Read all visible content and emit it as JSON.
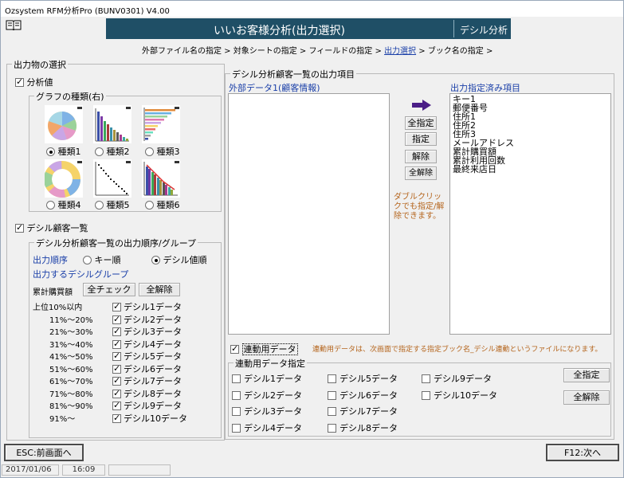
{
  "window": {
    "title": "Ozsystem RFM分析Pro (BUNV0301)   V4.00"
  },
  "banner": {
    "title": "いいお客様分析(出力選択)",
    "subtitle": "デシル分析"
  },
  "steps": [
    "外部ファイル名の指定",
    "対象シートの指定",
    "フィールドの指定",
    "出力選択",
    "ブック名の指定"
  ],
  "output_select": {
    "legend": "出力物の選択",
    "analysis_value": {
      "label": "分析値",
      "checked": true
    },
    "graph_group": {
      "legend": "グラフの種類(右)",
      "types": [
        {
          "label": "種類1",
          "selected": true
        },
        {
          "label": "種類2",
          "selected": false
        },
        {
          "label": "種類3",
          "selected": false
        },
        {
          "label": "種類4",
          "selected": false
        },
        {
          "label": "種類5",
          "selected": false
        },
        {
          "label": "種類6",
          "selected": false
        }
      ]
    },
    "decile_customers": {
      "label": "デシル顧客一覧",
      "checked": true
    },
    "order_group": {
      "legend": "デシル分析顧客一覧の出力順序/グループ",
      "order_label": "出力順序",
      "order_key": "キー順",
      "order_decile": "デシル値順",
      "decile_group_label": "出力するデシルグループ",
      "cum_purchase_label": "累計購買額",
      "check_all": "全チェック",
      "clear_all": "全解除",
      "rows": [
        {
          "range": "上位10%以内",
          "label": "デシル1データ",
          "checked": true
        },
        {
          "range": "11%〜20%",
          "label": "デシル2データ",
          "checked": true
        },
        {
          "range": "21%〜30%",
          "label": "デシル3データ",
          "checked": true
        },
        {
          "range": "31%〜40%",
          "label": "デシル4データ",
          "checked": true
        },
        {
          "range": "41%〜50%",
          "label": "デシル5データ",
          "checked": true
        },
        {
          "range": "51%〜60%",
          "label": "デシル6データ",
          "checked": true
        },
        {
          "range": "61%〜70%",
          "label": "デシル7データ",
          "checked": true
        },
        {
          "range": "71%〜80%",
          "label": "デシル8データ",
          "checked": true
        },
        {
          "range": "81%〜90%",
          "label": "デシル9データ",
          "checked": true
        },
        {
          "range": "91%〜",
          "label": "デシル10データ",
          "checked": true
        }
      ]
    }
  },
  "output_items": {
    "legend": "デシル分析顧客一覧の出力項目",
    "external_label": "外部データ1(顧客情報)",
    "selected_label": "出力指定済み項目",
    "buttons": {
      "select_all": "全指定",
      "select": "指定",
      "remove": "解除",
      "remove_all": "全解除"
    },
    "hint": "ダブルクリックでも指定/解除できます。",
    "selected_items": [
      "キー1",
      "郵便番号",
      "住所1",
      "住所2",
      "住所3",
      "メールアドレス",
      "累計購買額",
      "累計利用回数",
      "最終来店日"
    ]
  },
  "linked": {
    "checkbox_label": "連動用データ",
    "checked": true,
    "note": "連動用データは、次画面で指定する指定ブック名_デシル連動というファイルになります。",
    "group_legend": "連動用データ指定",
    "items": [
      "デシル1データ",
      "デシル2データ",
      "デシル3データ",
      "デシル4データ",
      "デシル5データ",
      "デシル6データ",
      "デシル7データ",
      "デシル8データ",
      "デシル9データ",
      "デシル10データ"
    ],
    "select_all": "全指定",
    "clear_all": "全解除"
  },
  "footer": {
    "back": "ESC:前画面へ",
    "next": "F12:次へ"
  },
  "status": {
    "date": "2017/01/06",
    "time": "16:09"
  },
  "colors": {
    "banner": "#1f4f66",
    "link": "#1a3fa8",
    "arrow": "#4b1e87"
  }
}
